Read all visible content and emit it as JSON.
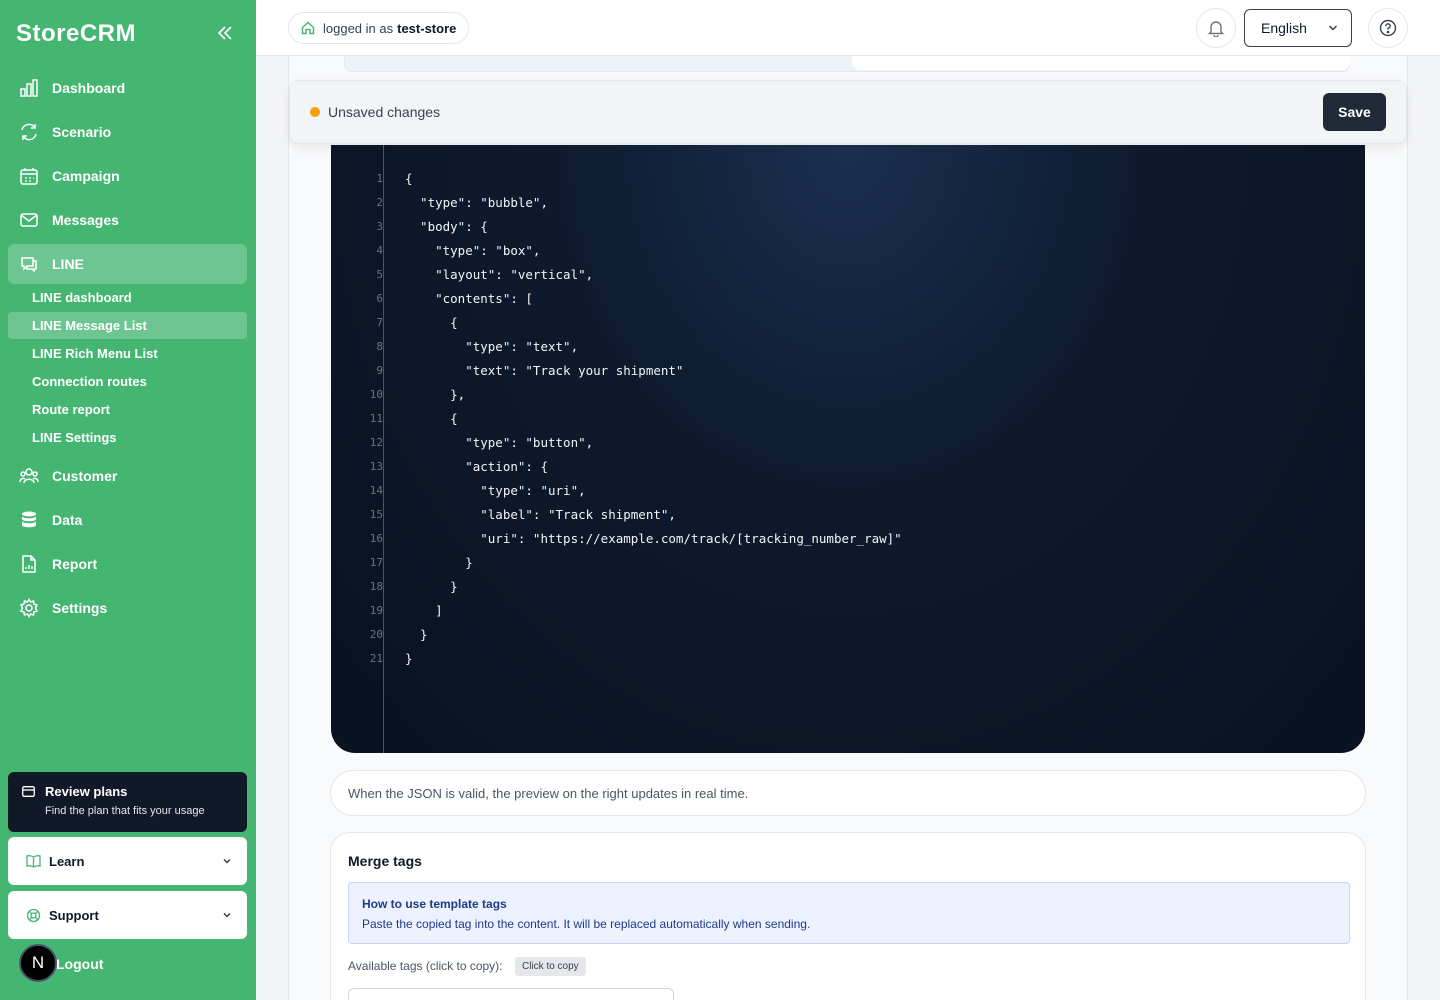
{
  "sidebar": {
    "brand": "StoreCRM",
    "nav": [
      {
        "label": "Dashboard",
        "icon": "bar-chart-icon"
      },
      {
        "label": "Scenario",
        "icon": "refresh-icon"
      },
      {
        "label": "Campaign",
        "icon": "calendar-icon"
      },
      {
        "label": "Messages",
        "icon": "mail-icon"
      },
      {
        "label": "LINE",
        "icon": "chat-icon"
      },
      {
        "label": "Customer",
        "icon": "users-icon"
      },
      {
        "label": "Data",
        "icon": "database-icon"
      },
      {
        "label": "Report",
        "icon": "report-icon"
      },
      {
        "label": "Settings",
        "icon": "gear-icon"
      }
    ],
    "line_sub": [
      "LINE dashboard",
      "LINE Message List",
      "LINE Rich Menu List",
      "Connection routes",
      "Route report",
      "LINE Settings"
    ],
    "review": {
      "title": "Review plans",
      "subtitle": "Find the plan that fits your usage"
    },
    "learn": "Learn",
    "support": "Support",
    "logout": "Logout",
    "avatar_initial": "N"
  },
  "header": {
    "logged_in_prefix": "logged in as",
    "store": "test-store",
    "language": "English"
  },
  "unsaved": {
    "text": "Unsaved changes",
    "save_label": "Save",
    "dot_color": "#f59e0b"
  },
  "editor": {
    "line_numbers": [
      "1",
      "2",
      "3",
      "4",
      "5",
      "6",
      "7",
      "8",
      "9",
      "10",
      "11",
      "12",
      "13",
      "14",
      "15",
      "16",
      "17",
      "18",
      "19",
      "20",
      "21"
    ],
    "lines": [
      "{",
      "  \"type\": \"bubble\",",
      "  \"body\": {",
      "    \"type\": \"box\",",
      "    \"layout\": \"vertical\",",
      "    \"contents\": [",
      "      {",
      "        \"type\": \"text\",",
      "        \"text\": \"Track your shipment\"",
      "      },",
      "      {",
      "        \"type\": \"button\",",
      "        \"action\": {",
      "          \"type\": \"uri\",",
      "          \"label\": \"Track shipment\",",
      "          \"uri\": \"https://example.com/track/[tracking_number_raw]\"",
      "        }",
      "      }",
      "    ]",
      "  }",
      "}"
    ]
  },
  "hint": "When the JSON is valid, the preview on the right updates in real time.",
  "merge": {
    "title": "Merge tags",
    "info_title": "How to use template tags",
    "info_body": "Paste the copied tag into the content. It will be replaced automatically when sending.",
    "tags_label": "Available tags (click to copy):",
    "copy_chip": "Click to copy"
  }
}
